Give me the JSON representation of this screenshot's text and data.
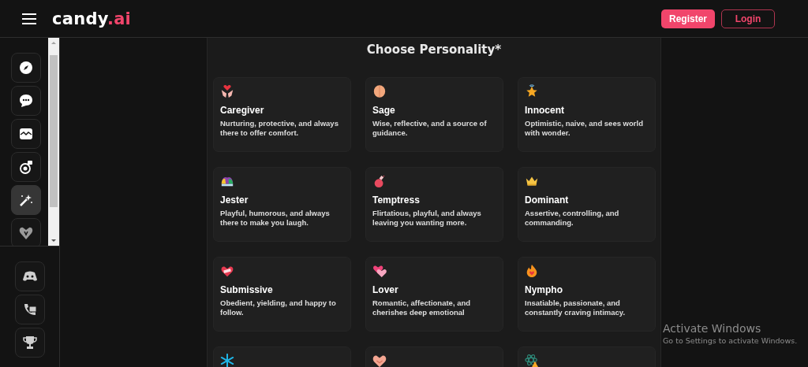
{
  "header": {
    "logo": {
      "text": "candy",
      "accent": ".ai"
    },
    "buttons": [
      {
        "label": "Register",
        "kind": "primary"
      },
      {
        "label": "Login",
        "kind": "outline"
      }
    ]
  },
  "sidebar": {
    "items": [
      {
        "kind": "compass",
        "selected": false
      },
      {
        "kind": "chat",
        "selected": false
      },
      {
        "kind": "image",
        "selected": false
      },
      {
        "kind": "camera",
        "selected": false
      },
      {
        "kind": "wand",
        "selected": true
      },
      {
        "kind": "heart",
        "selected": false
      }
    ],
    "bottom_items": [
      {
        "kind": "gamepad"
      },
      {
        "kind": "phone"
      },
      {
        "kind": "trophy"
      }
    ]
  },
  "personality": {
    "title": "Choose Personality*",
    "cards": [
      {
        "kind": "hands",
        "title": "Caregiver",
        "description": "Nurturing, protective, and always there to offer comfort."
      },
      {
        "kind": "brain",
        "title": "Sage",
        "description": "Wise, reflective, and a source of guidance."
      },
      {
        "kind": "star",
        "title": "Innocent",
        "description": "Optimistic, naive, and sees world with wonder."
      },
      {
        "kind": "jester",
        "title": "Jester",
        "description": "Playful, humorous, and always there to make you laugh."
      },
      {
        "kind": "potion",
        "title": "Temptress",
        "description": "Flirtatious, playful, and always leaving you wanting more."
      },
      {
        "kind": "crown",
        "title": "Dominant",
        "description": "Assertive, controlling, and commanding."
      },
      {
        "kind": "letter",
        "title": "Submissive",
        "description": "Obedient, yielding, and happy to follow."
      },
      {
        "kind": "hearts",
        "title": "Lover",
        "description": "Romantic, affectionate, and cherishes deep emotional"
      },
      {
        "kind": "flame",
        "title": "Nympho",
        "description": "Insatiable, passionate, and constantly craving intimacy."
      },
      {
        "kind": "snowflake"
      },
      {
        "kind": "handshake"
      },
      {
        "kind": "atom"
      }
    ]
  },
  "os_overlay": {
    "title": "Activate Windows",
    "subtitle": "Go to Settings to activate Windows."
  }
}
